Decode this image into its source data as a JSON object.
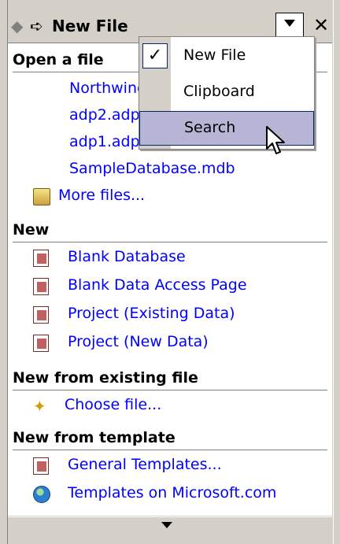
{
  "pane": {
    "title": "New File",
    "back_icon": "back-arrow-icon",
    "forward_icon": "forward-arrow-icon",
    "close_symbol": "✕"
  },
  "open": {
    "heading": "Open a file",
    "files": [
      "Northwind",
      "adp2.adp",
      "adp1.adp",
      "SampleDatabase.mdb"
    ],
    "more": "More files..."
  },
  "new": {
    "heading": "New",
    "items": [
      "Blank Database",
      "Blank Data Access Page",
      "Project (Existing Data)",
      "Project (New Data)"
    ]
  },
  "existing": {
    "heading": "New from existing file",
    "item": "Choose file..."
  },
  "template": {
    "heading": "New from template",
    "items": [
      "General Templates...",
      "Templates on Microsoft.com"
    ]
  },
  "menu": {
    "items": [
      "New File",
      "Clipboard",
      "Search"
    ],
    "checked_symbol": "✓",
    "highlight_color": "#b6b5d6"
  },
  "colors": {
    "link": "#0000ff",
    "chrome": "#d4d0c8"
  }
}
